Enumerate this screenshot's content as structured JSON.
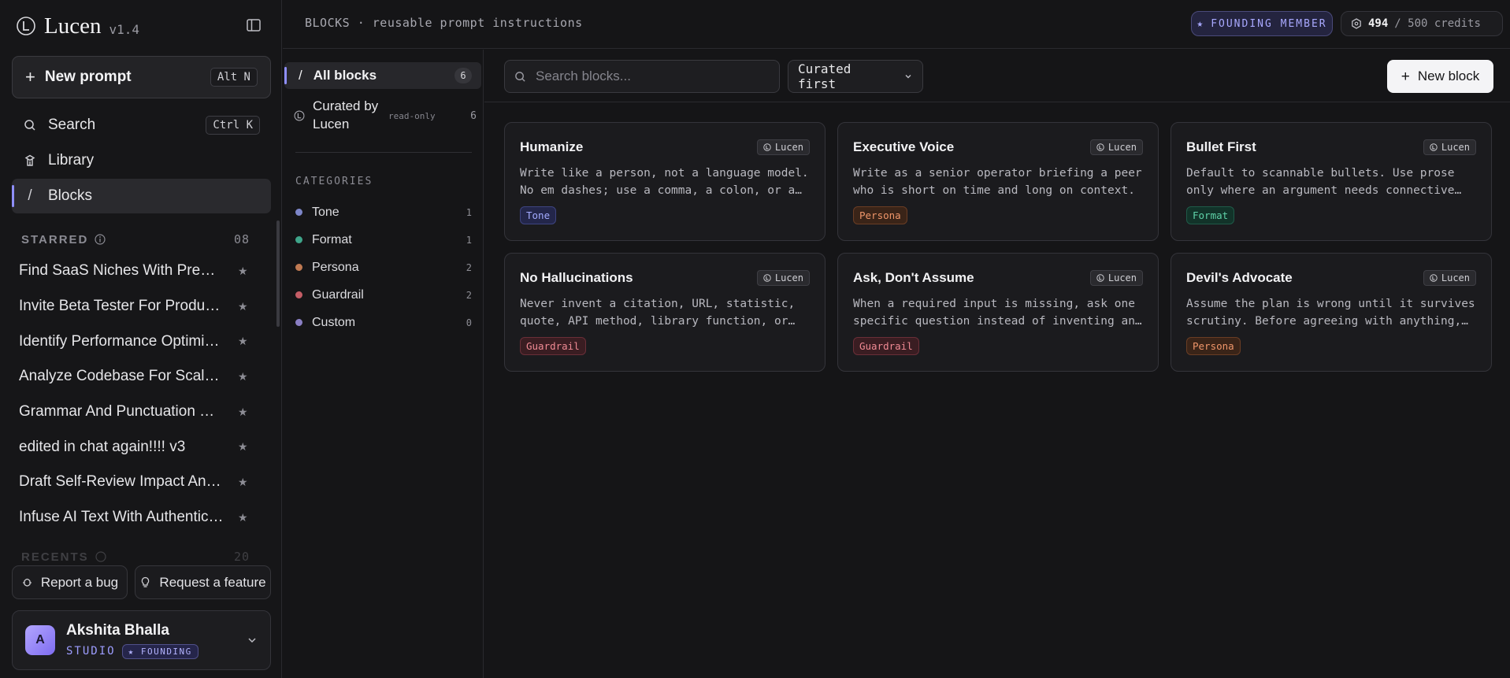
{
  "app": {
    "name": "Lucen",
    "version": "v1.4"
  },
  "sidebar": {
    "new_prompt": {
      "label": "New prompt",
      "shortcut": "Alt N"
    },
    "nav": [
      {
        "label": "Search",
        "shortcut": "Ctrl K",
        "icon": "search-icon"
      },
      {
        "label": "Library",
        "icon": "library-icon"
      },
      {
        "label": "Blocks",
        "icon": "slash-icon",
        "active": true
      }
    ],
    "starred": {
      "title": "STARRED",
      "count": "08",
      "items": [
        "Find SaaS Niches With Premium Pricing",
        "Invite Beta Tester For Product Testing",
        "Identify Performance Optimization Opportunities",
        "Analyze Codebase For Scalability Issues",
        "Grammar And Punctuation Review",
        "edited in chat again!!!! v3",
        "Draft Self-Review Impact And Evidence",
        "Infuse AI Text With Authentic Human Voice"
      ]
    },
    "recents": {
      "title": "RECENTS",
      "count": "20"
    },
    "footer": {
      "report_bug": "Report a bug",
      "request_feature": "Request a feature"
    },
    "user": {
      "initial": "A",
      "name": "Akshita Bhalla",
      "plan": "STUDIO",
      "badge": "★ FOUNDING"
    }
  },
  "header": {
    "breadcrumb": "BLOCKS · reusable prompt instructions",
    "member_badge": "FOUNDING MEMBER",
    "credits_used": "494",
    "credits_total": "/ 500 credits"
  },
  "categories": {
    "all": {
      "label": "All blocks",
      "count": "6"
    },
    "curated": {
      "label": "Curated by Lucen",
      "note": "read-only",
      "count": "6"
    },
    "title": "CATEGORIES",
    "items": [
      {
        "label": "Tone",
        "count": "1",
        "color": "#7d86c9"
      },
      {
        "label": "Format",
        "count": "1",
        "color": "#3fa58a"
      },
      {
        "label": "Persona",
        "count": "2",
        "color": "#c07a52"
      },
      {
        "label": "Guardrail",
        "count": "2",
        "color": "#c45d66"
      },
      {
        "label": "Custom",
        "count": "0",
        "color": "#8a7fc4"
      }
    ]
  },
  "toolbar": {
    "search_placeholder": "Search blocks...",
    "sort_label": "Curated first",
    "new_block": "New block"
  },
  "blocks": [
    {
      "title": "Humanize",
      "source": "Lucen",
      "description": "Write like a person, not a language model. No em dashes; use a comma, a colon, or a period instead.",
      "tag": "Tone",
      "tag_style": {
        "bg": "#23264a",
        "border": "#3e4480",
        "fg": "#a3abff"
      }
    },
    {
      "title": "Executive Voice",
      "source": "Lucen",
      "description": "Write as a senior operator briefing a peer who is short on time and long on context.",
      "tag": "Persona",
      "tag_style": {
        "bg": "#3a2418",
        "border": "#6a3d24",
        "fg": "#f0966a"
      }
    },
    {
      "title": "Bullet First",
      "source": "Lucen",
      "description": "Default to scannable bullets. Use prose only where an argument needs connective tissue.",
      "tag": "Format",
      "tag_style": {
        "bg": "#123329",
        "border": "#1f5a48",
        "fg": "#5fd2a8"
      }
    },
    {
      "title": "No Hallucinations",
      "source": "Lucen",
      "description": "Never invent a citation, URL, statistic, quote, API method, library function, or fact.",
      "tag": "Guardrail",
      "tag_style": {
        "bg": "#3a1d22",
        "border": "#6a2f38",
        "fg": "#f08a94"
      }
    },
    {
      "title": "Ask, Don't Assume",
      "source": "Lucen",
      "description": "When a required input is missing, ask one specific question instead of inventing an answer.",
      "tag": "Guardrail",
      "tag_style": {
        "bg": "#3a1d22",
        "border": "#6a2f38",
        "fg": "#f08a94"
      }
    },
    {
      "title": "Devil's Advocate",
      "source": "Lucen",
      "description": "Assume the plan is wrong until it survives scrutiny. Before agreeing with anything, find the flaw.",
      "tag": "Persona",
      "tag_style": {
        "bg": "#3a2418",
        "border": "#6a3d24",
        "fg": "#f0966a"
      }
    }
  ]
}
